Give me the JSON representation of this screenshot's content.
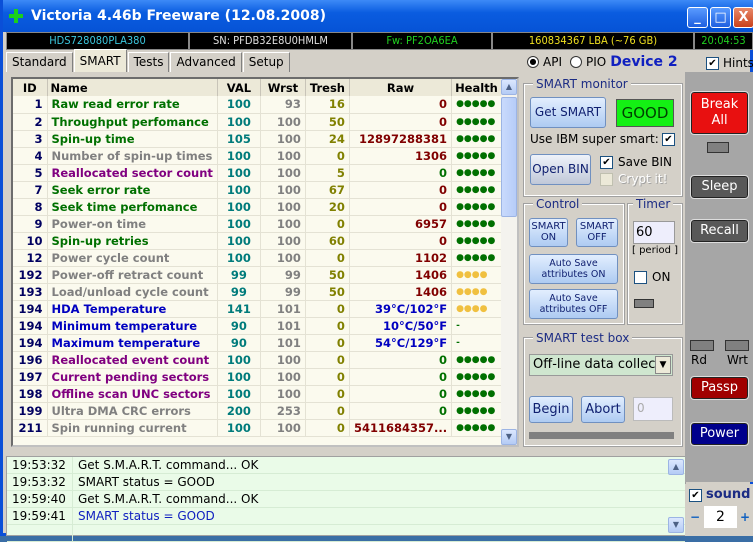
{
  "window": {
    "title": "Victoria 4.46b Freeware (12.08.2008)",
    "minimize": "_",
    "maximize": "□",
    "close": "X"
  },
  "info": {
    "model": "HDS728080PLA380",
    "serial": "SN: PFDB32E8U0HMLM",
    "firmware": "Fw: PF2OA6EA",
    "lba": "160834367 LBA (~76 GB)",
    "clock": "20:04:53"
  },
  "tabs": [
    "Standard",
    "SMART",
    "Tests",
    "Advanced",
    "Setup"
  ],
  "mode": {
    "api": "API",
    "pio": "PIO",
    "device": "Device 2",
    "hints": "Hints"
  },
  "table": {
    "headers": [
      "ID",
      "Name",
      "VAL",
      "Wrst",
      "Tresh",
      "Raw",
      "Health"
    ],
    "rows": [
      {
        "id": "1",
        "name": "Raw read error rate",
        "val": "100",
        "wrst": "93",
        "tresh": "16",
        "raw": "0",
        "health": "●●●●●",
        "nc": "#007000",
        "rc": "#800000",
        "hc": "#007000"
      },
      {
        "id": "2",
        "name": "Throughput perfomance",
        "val": "100",
        "wrst": "100",
        "tresh": "50",
        "raw": "0",
        "health": "●●●●●",
        "nc": "#007000",
        "rc": "#800000",
        "hc": "#007000"
      },
      {
        "id": "3",
        "name": "Spin-up time",
        "val": "105",
        "wrst": "100",
        "tresh": "24",
        "raw": "12897288381",
        "health": "●●●●●",
        "nc": "#007000",
        "rc": "#800000",
        "hc": "#007000"
      },
      {
        "id": "4",
        "name": "Number of spin-up times",
        "val": "100",
        "wrst": "100",
        "tresh": "0",
        "raw": "1306",
        "health": "●●●●●",
        "nc": "#808080",
        "rc": "#800000",
        "hc": "#007000"
      },
      {
        "id": "5",
        "name": "Reallocated sector count",
        "val": "100",
        "wrst": "100",
        "tresh": "5",
        "raw": "0",
        "health": "●●●●●",
        "nc": "#800080",
        "rc": "#007000",
        "hc": "#007000"
      },
      {
        "id": "7",
        "name": "Seek error rate",
        "val": "100",
        "wrst": "100",
        "tresh": "67",
        "raw": "0",
        "health": "●●●●●",
        "nc": "#007000",
        "rc": "#800000",
        "hc": "#007000"
      },
      {
        "id": "8",
        "name": "Seek time perfomance",
        "val": "100",
        "wrst": "100",
        "tresh": "20",
        "raw": "0",
        "health": "●●●●●",
        "nc": "#007000",
        "rc": "#800000",
        "hc": "#007000"
      },
      {
        "id": "9",
        "name": "Power-on time",
        "val": "100",
        "wrst": "100",
        "tresh": "0",
        "raw": "6957",
        "health": "●●●●●",
        "nc": "#808080",
        "rc": "#800000",
        "hc": "#007000"
      },
      {
        "id": "10",
        "name": "Spin-up retries",
        "val": "100",
        "wrst": "100",
        "tresh": "60",
        "raw": "0",
        "health": "●●●●●",
        "nc": "#007000",
        "rc": "#800000",
        "hc": "#007000"
      },
      {
        "id": "12",
        "name": "Power cycle count",
        "val": "100",
        "wrst": "100",
        "tresh": "0",
        "raw": "1102",
        "health": "●●●●●",
        "nc": "#808080",
        "rc": "#800000",
        "hc": "#007000"
      },
      {
        "id": "192",
        "name": "Power-off retract count",
        "val": "99",
        "wrst": "99",
        "tresh": "50",
        "raw": "1406",
        "health": "●●●●",
        "nc": "#808080",
        "rc": "#800000",
        "hc": "#f0c040"
      },
      {
        "id": "193",
        "name": "Load/unload cycle count",
        "val": "99",
        "wrst": "99",
        "tresh": "50",
        "raw": "1406",
        "health": "●●●●",
        "nc": "#808080",
        "rc": "#800000",
        "hc": "#f0c040"
      },
      {
        "id": "194",
        "name": "HDA Temperature",
        "val": "141",
        "wrst": "101",
        "tresh": "0",
        "raw": "39°C/102°F",
        "health": "●●●●",
        "nc": "#0000c0",
        "rc": "#0000c0",
        "hc": "#f0c040"
      },
      {
        "id": "194",
        "name": "Minimum temperature",
        "val": "90",
        "wrst": "101",
        "tresh": "0",
        "raw": "10°C/50°F",
        "health": "-",
        "nc": "#0000c0",
        "rc": "#0000c0",
        "hc": "#007000"
      },
      {
        "id": "194",
        "name": "Maximum temperature",
        "val": "90",
        "wrst": "101",
        "tresh": "0",
        "raw": "54°C/129°F",
        "health": "-",
        "nc": "#0000c0",
        "rc": "#0000c0",
        "hc": "#007000"
      },
      {
        "id": "196",
        "name": "Reallocated event count",
        "val": "100",
        "wrst": "100",
        "tresh": "0",
        "raw": "0",
        "health": "●●●●●",
        "nc": "#800080",
        "rc": "#007000",
        "hc": "#007000"
      },
      {
        "id": "197",
        "name": "Current pending sectors",
        "val": "100",
        "wrst": "100",
        "tresh": "0",
        "raw": "0",
        "health": "●●●●●",
        "nc": "#800080",
        "rc": "#007000",
        "hc": "#007000"
      },
      {
        "id": "198",
        "name": "Offline scan UNC sectors",
        "val": "100",
        "wrst": "100",
        "tresh": "0",
        "raw": "0",
        "health": "●●●●●",
        "nc": "#800080",
        "rc": "#007000",
        "hc": "#007000"
      },
      {
        "id": "199",
        "name": "Ultra DMA CRC errors",
        "val": "200",
        "wrst": "253",
        "tresh": "0",
        "raw": "0",
        "health": "●●●●●",
        "nc": "#808080",
        "rc": "#007000",
        "hc": "#007000"
      },
      {
        "id": "211",
        "name": "Spin running current",
        "val": "100",
        "wrst": "100",
        "tresh": "0",
        "raw": "5411684357...",
        "health": "●●●●●",
        "nc": "#808080",
        "rc": "#800000",
        "hc": "#007000"
      }
    ]
  },
  "smart_monitor": {
    "title": "SMART monitor",
    "get_smart": "Get SMART",
    "status": "GOOD",
    "ibm_label": "Use IBM super smart:",
    "open_bin": "Open BIN",
    "save_bin": "Save BIN",
    "crypt": "Crypt it!"
  },
  "control": {
    "title": "Control",
    "smart_on": "SMART ON",
    "smart_off": "SMART OFF",
    "autosave_on": "Auto Save attributes ON",
    "autosave_off": "Auto Save attributes OFF"
  },
  "timer": {
    "title": "Timer",
    "value": "60",
    "period": "[ period ]",
    "on": "ON"
  },
  "test_box": {
    "title": "SMART test box",
    "selected": "Off-line data collect",
    "begin": "Begin",
    "abort": "Abort",
    "counter": "0"
  },
  "side": {
    "break": "Break All",
    "sleep": "Sleep",
    "recall": "Recall",
    "rd": "Rd",
    "wrt": "Wrt",
    "passp": "Passp",
    "power": "Power",
    "sound": "sound",
    "minus": "−",
    "plus": "+",
    "sound_value": "2"
  },
  "log": [
    {
      "time": "19:53:32",
      "msg": "Get S.M.A.R.T. command... OK",
      "color": "#000000"
    },
    {
      "time": "19:53:32",
      "msg": "SMART status = GOOD",
      "color": "#000000"
    },
    {
      "time": "19:59:40",
      "msg": "Get S.M.A.R.T. command... OK",
      "color": "#000000"
    },
    {
      "time": "19:59:41",
      "msg": "SMART status = GOOD",
      "color": "#1020c0"
    }
  ]
}
